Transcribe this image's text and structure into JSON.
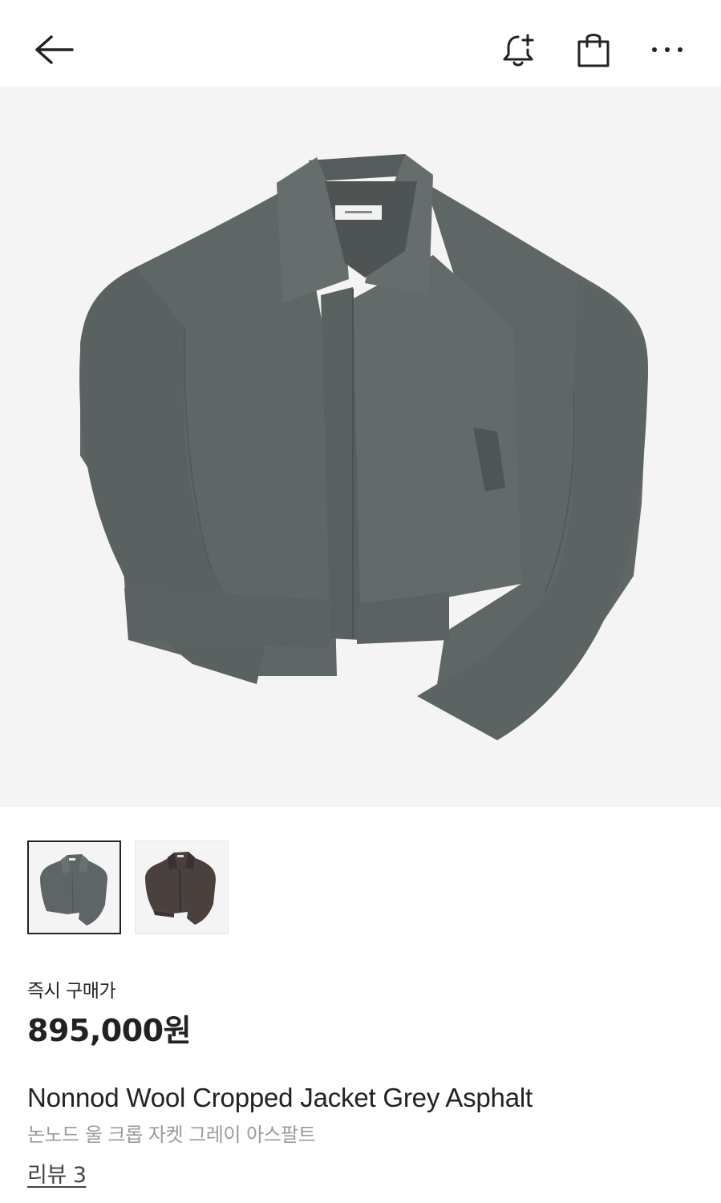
{
  "header": {
    "icons": [
      "arrow-left-icon",
      "bell-plus-icon",
      "shopping-bag-icon",
      "more-horizontal-icon"
    ]
  },
  "product": {
    "price_label": "즉시 구매가",
    "price": "895,000원",
    "name": "Nonnod Wool Cropped Jacket Grey Asphalt",
    "name_kr": "논노드 울 크롭 자켓 그레이 아스팔트",
    "review_link": "리뷰 3",
    "thumbnails": [
      {
        "variant": "grey",
        "selected": true,
        "color": "#5e6566"
      },
      {
        "variant": "brown",
        "selected": false,
        "color": "#4a403d"
      }
    ]
  },
  "colors": {
    "jacket_grey": "#5f6666",
    "background": "#f4f4f4",
    "text_primary": "#222222",
    "text_secondary": "#9a9a9a"
  }
}
